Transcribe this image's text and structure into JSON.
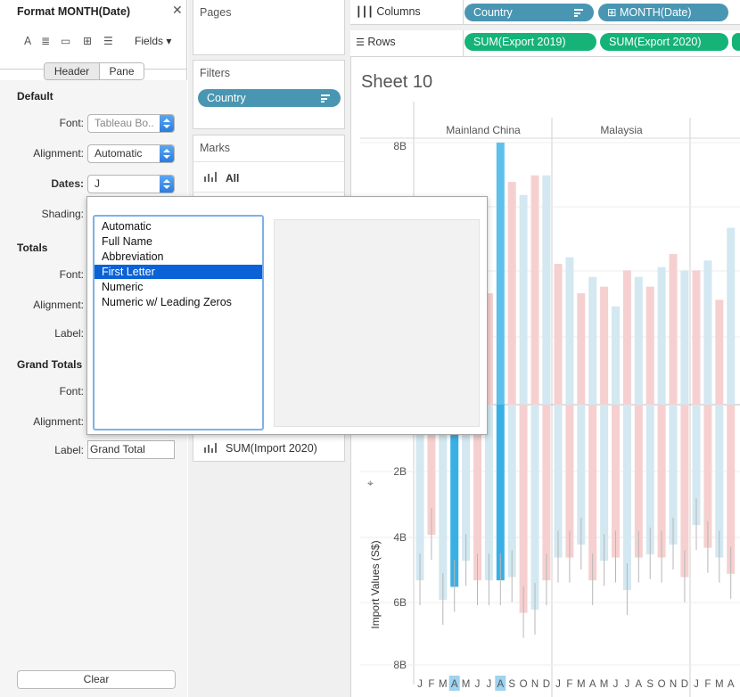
{
  "format_pane": {
    "title": "Format MONTH(Date)",
    "fields_label": "Fields ▾",
    "tabs": [
      "Header",
      "Pane"
    ],
    "sections": {
      "default": "Default",
      "totals": "Totals",
      "grand_totals": "Grand Totals"
    },
    "labels": {
      "font": "Font:",
      "alignment": "Alignment:",
      "dates": "Dates:",
      "shading": "Shading:",
      "label": "Label:"
    },
    "values": {
      "font": "Tableau Bo..",
      "alignment": "Automatic",
      "dates": "J",
      "grand_total_label": "Grand Total"
    },
    "clear_label": "Clear"
  },
  "date_options": {
    "items": [
      "Automatic",
      "Full Name",
      "Abbreviation",
      "First Letter",
      "Numeric",
      "Numeric w/ Leading Zeros"
    ],
    "selected_index": 3
  },
  "shelves": {
    "pages_title": "Pages",
    "filters_title": "Filters",
    "filter_pill": "Country",
    "marks_title": "Marks",
    "marks_all": "All",
    "marks_bottom": "SUM(Import 2020)",
    "columns_label": "Columns",
    "rows_label": "Rows",
    "column_pills": [
      "Country",
      "⊞ MONTH(Date)"
    ],
    "row_pills": [
      "SUM(Export 2019)",
      "SUM(Export 2020)"
    ]
  },
  "sheet": {
    "title": "Sheet 10"
  },
  "colors": {
    "blue_pill": "#4996b2",
    "green_pill": "#15b377",
    "bar_pink": "#f6d0d0",
    "bar_blue": "#d3e8f1",
    "highlight": "#5fc1ea",
    "selection": "#0b62d6"
  },
  "chart_data": {
    "type": "bar",
    "countries": [
      "Mainland China",
      "Malaysia",
      "Uni"
    ],
    "months": [
      "J",
      "F",
      "M",
      "A",
      "M",
      "J",
      "J",
      "A",
      "S",
      "O",
      "N",
      "D"
    ],
    "highlighted_month": "A",
    "upper_axis_ticks": [
      "8B"
    ],
    "lower_axis_ticks": [
      "2B",
      "4B",
      "6B",
      "8B"
    ],
    "ylabel": "Import Values (S$)",
    "upper_panel_visible": {
      "Mainland China": [
        4.0,
        3.9,
        4.1,
        4.7,
        4.6,
        4.5,
        3.4,
        8.0,
        6.8,
        6.4,
        7.0,
        7.0
      ],
      "Malaysia": [
        4.3,
        4.5,
        3.4,
        3.9,
        3.6,
        3.0,
        4.1,
        3.9,
        3.6,
        4.2,
        4.6,
        4.1
      ],
      "Uni": [
        4.1,
        4.4,
        3.2,
        5.4,
        5.6
      ]
    },
    "lower_panel": {
      "Mainland China": [
        5.4,
        4.0,
        6.0,
        5.6,
        4.8,
        5.4,
        5.4,
        5.4,
        5.3,
        6.4,
        6.3,
        5.4
      ],
      "Malaysia": [
        4.7,
        4.7,
        4.3,
        5.4,
        4.8,
        4.7,
        5.7,
        4.7,
        4.6,
        4.7,
        4.3,
        5.3
      ],
      "Uni": [
        3.7,
        4.4,
        4.7,
        5.2,
        5.5
      ]
    }
  }
}
